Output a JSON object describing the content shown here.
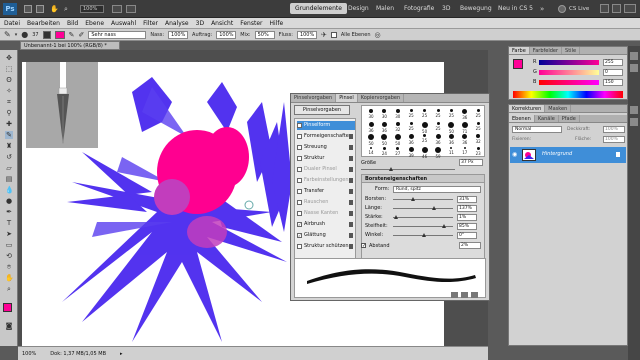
{
  "app": {
    "logo": "Ps",
    "workspaces": [
      "Grundelemente",
      "Design",
      "Malen",
      "Fotografie",
      "3D",
      "Bewegung",
      "Neu in CS 5"
    ],
    "active_workspace": "Grundelemente",
    "cs_live": "CS Live"
  },
  "menu": [
    "Datei",
    "Bearbeiten",
    "Bild",
    "Ebene",
    "Auswahl",
    "Filter",
    "Analyse",
    "3D",
    "Ansicht",
    "Fenster",
    "Hilfe"
  ],
  "options": {
    "size": "37",
    "mode_label": "Modus:",
    "mode_value": "Sehr nass",
    "nass_label": "Nass:",
    "nass_value": "100%",
    "auftrag_label": "Auftrag:",
    "auftrag_value": "100%",
    "mix_label": "Mix:",
    "mix_value": "50%",
    "fluss_label": "Fluss:",
    "fluss_value": "100%",
    "alle_ebenen": "Alle Ebenen"
  },
  "document": {
    "tab_title": "Unbenannt-1 bei 100% (RGB/8) *"
  },
  "status": {
    "zoom": "100%",
    "doc": "Dok: 1,37 MB/1,05 MB"
  },
  "brush_panel": {
    "tabs": [
      "Pinselvorgaben",
      "Pinsel",
      "Kopiervorgaben"
    ],
    "active_tab": "Pinsel",
    "presets_button": "Pinselvorgaben",
    "list": [
      {
        "label": "Pinselform",
        "checked": false,
        "selected": true,
        "disabled": false,
        "lock": false
      },
      {
        "label": "Formeigenschaften",
        "checked": false,
        "selected": false,
        "disabled": false,
        "lock": true
      },
      {
        "label": "Streuung",
        "checked": false,
        "selected": false,
        "disabled": false,
        "lock": true
      },
      {
        "label": "Struktur",
        "checked": false,
        "selected": false,
        "disabled": false,
        "lock": true
      },
      {
        "label": "Dualer Pinsel",
        "checked": false,
        "selected": false,
        "disabled": true,
        "lock": true
      },
      {
        "label": "Farbeinstellungen",
        "checked": false,
        "selected": false,
        "disabled": true,
        "lock": true
      },
      {
        "label": "Transfer",
        "checked": false,
        "selected": false,
        "disabled": false,
        "lock": true
      },
      {
        "label": "Rauschen",
        "checked": false,
        "selected": false,
        "disabled": true,
        "lock": true
      },
      {
        "label": "Nasse Kanten",
        "checked": false,
        "selected": false,
        "disabled": true,
        "lock": true
      },
      {
        "label": "Airbrush",
        "checked": true,
        "selected": false,
        "disabled": false,
        "lock": true
      },
      {
        "label": "Glättung",
        "checked": true,
        "selected": false,
        "disabled": false,
        "lock": true
      },
      {
        "label": "Struktur schützen",
        "checked": false,
        "selected": false,
        "disabled": false,
        "lock": true
      }
    ],
    "tips": [
      "30",
      "30",
      "30",
      "25",
      "25",
      "25",
      "25",
      "36",
      "25",
      "36",
      "36",
      "32",
      "25",
      "50",
      "25",
      "50",
      "71",
      "25",
      "50",
      "50",
      "50",
      "36",
      "25",
      "36",
      "36",
      "36",
      "32",
      "14",
      "24",
      "27",
      "39",
      "46",
      "59",
      "11",
      "17",
      "23"
    ],
    "size_label": "Größe",
    "size_value": "37 Px",
    "section_title": "Borsteneigenschaften",
    "form_label": "Form:",
    "form_value": "Rund, spitz",
    "rows": [
      {
        "label": "Borsten:",
        "value": "31%",
        "pos": 0.31
      },
      {
        "label": "Länge:",
        "value": "137%",
        "pos": 0.68
      },
      {
        "label": "Stärke:",
        "value": "1%",
        "pos": 0.02
      },
      {
        "label": "Steifheit:",
        "value": "85%",
        "pos": 0.85
      },
      {
        "label": "Winkel:",
        "value": "0°",
        "pos": 0.5
      }
    ],
    "abstand_label": "Abstand",
    "abstand_value": "2%"
  },
  "color_panel": {
    "tabs": [
      "Farbe",
      "Farbfelder",
      "Stile"
    ],
    "active_tab": "Farbe",
    "channels": [
      {
        "label": "R",
        "value": "255"
      },
      {
        "label": "G",
        "value": "0"
      },
      {
        "label": "B",
        "value": "150"
      }
    ],
    "fg_color": "#ff0096"
  },
  "layers_panel": {
    "top_tabs": [
      "Korrekturen",
      "Masken"
    ],
    "tabs": [
      "Ebenen",
      "Kanäle",
      "Pfade"
    ],
    "active_tab": "Ebenen",
    "blend_mode": "Normal",
    "opacity_label": "Deckkraft:",
    "opacity_value": "100%",
    "fix_label": "Fixieren:",
    "fill_label": "Fläche:",
    "fill_value": "100%",
    "layer_name": "Hintergrund"
  },
  "colors": {
    "accent": "#3f8ed8",
    "paint_blue": "#4422ee",
    "paint_pink": "#ff0090",
    "paint_purple": "#c23dbd"
  }
}
